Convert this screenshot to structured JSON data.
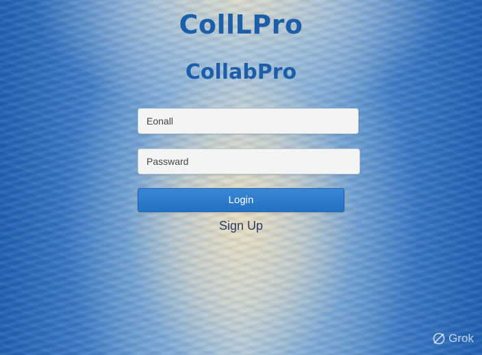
{
  "app": {
    "header_title": "CollLPro",
    "subtitle": "CollabPro"
  },
  "form": {
    "email_placeholder": "Eonall",
    "password_placeholder": "Passward",
    "login_label": "Login",
    "signup_label": "Sign Up"
  },
  "watermark": {
    "text": "Grok",
    "icon": "grok-logo-icon"
  },
  "colors": {
    "brand_blue": "#1d5ea8",
    "button_blue": "#2a7acb",
    "background_blue": "#1f5fb0"
  }
}
